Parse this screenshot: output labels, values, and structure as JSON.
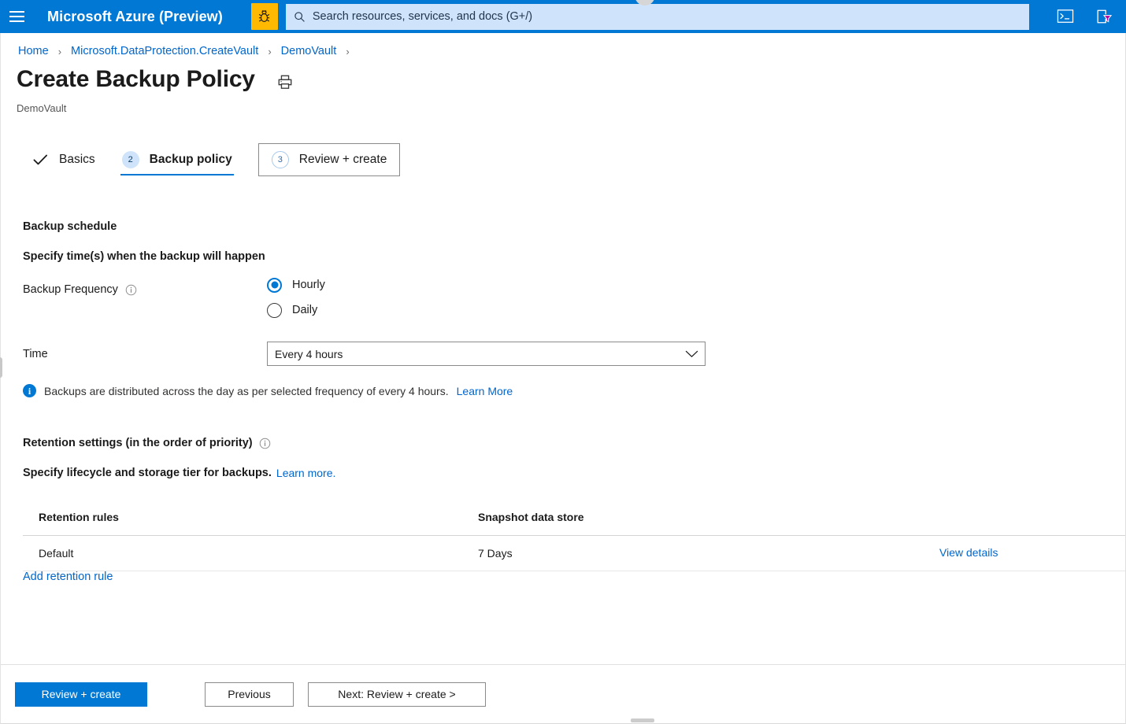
{
  "header": {
    "brand": "Microsoft Azure (Preview)",
    "menu_icon": "hamburger-icon",
    "preview_badge_icon": "bug-icon",
    "search_placeholder": "Search resources, services, and docs (G+/)",
    "search_value": "",
    "search_icon": "search-icon",
    "icons": [
      {
        "name": "cloud-shell-icon",
        "title": "Cloud Shell"
      },
      {
        "name": "directory-filter-icon",
        "title": "Directories + subscriptions"
      }
    ],
    "accent_color": "#0078d4",
    "badge_color": "#ffb900",
    "search_bg": "#cfe4fa"
  },
  "breadcrumb": {
    "items": [
      {
        "label": "Home"
      },
      {
        "label": "Microsoft.DataProtection.CreateVault"
      },
      {
        "label": "DemoVault"
      }
    ],
    "separator": "›"
  },
  "page": {
    "title": "Create Backup Policy",
    "subtitle": "DemoVault",
    "print_icon": "printer-icon"
  },
  "tabs": [
    {
      "label": "Basics",
      "state": "completed",
      "marker": "✓"
    },
    {
      "label": "Backup policy",
      "state": "active",
      "marker": "2"
    },
    {
      "label": "Review + create",
      "state": "upcoming",
      "marker": "3"
    }
  ],
  "form": {
    "backup_schedule_heading": "Backup schedule",
    "specify_times_label": "Specify time(s) when the backup will happen",
    "backup_frequency": {
      "label": "Backup Frequency",
      "info_icon": "info-circle-icon",
      "options": [
        {
          "label": "Hourly",
          "selected": true
        },
        {
          "label": "Daily",
          "selected": false
        }
      ]
    },
    "time": {
      "label": "Time",
      "value": "Every 4 hours",
      "chevron_icon": "chevron-down-icon"
    },
    "info_message": {
      "icon": "info-filled-icon",
      "text": "Backups are distributed across the day as per selected frequency of every 4 hours.",
      "link": "Learn More"
    },
    "retention": {
      "heading": "Retention settings (in the order of priority)",
      "heading_info_icon": "info-circle-icon",
      "subtext": "Specify lifecycle and storage tier for backups.",
      "subtext_link": "Learn more.",
      "table": {
        "columns": [
          "Retention rules",
          "Snapshot data store",
          ""
        ],
        "rows": [
          {
            "rule": "Default",
            "snapshot_data_store": "7 Days",
            "action": "View details"
          }
        ]
      },
      "add_rule_link": "Add retention rule"
    }
  },
  "footer": {
    "primary": "Review + create",
    "previous": "Previous",
    "next": "Next: Review + create >"
  }
}
